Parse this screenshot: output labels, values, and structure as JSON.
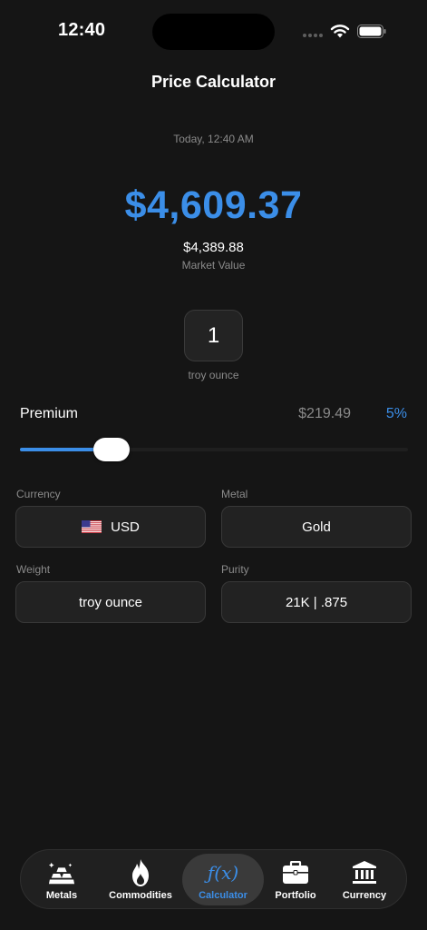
{
  "status": {
    "time": "12:40"
  },
  "header": {
    "title": "Price Calculator"
  },
  "summary": {
    "timestamp": "Today, 12:40 AM",
    "price": "$4,609.37",
    "market_value": "$4,389.88",
    "market_value_label": "Market Value"
  },
  "quantity": {
    "value": "1",
    "unit": "troy ounce"
  },
  "premium": {
    "label": "Premium",
    "amount": "$219.49",
    "percent": "5%",
    "slider_level": 0.19
  },
  "fields": {
    "currency": {
      "label": "Currency",
      "value": "USD",
      "flag": "us-flag-icon"
    },
    "metal": {
      "label": "Metal",
      "value": "Gold"
    },
    "weight": {
      "label": "Weight",
      "value": "troy ounce"
    },
    "purity": {
      "label": "Purity",
      "value": "21K | .875"
    }
  },
  "tabs": [
    {
      "label": "Metals",
      "icon": "gold-bars-icon",
      "active": false
    },
    {
      "label": "Commodities",
      "icon": "flame-icon",
      "active": false
    },
    {
      "label": "Calculator",
      "icon": "function-icon",
      "active": true
    },
    {
      "label": "Portfolio",
      "icon": "briefcase-icon",
      "active": false
    },
    {
      "label": "Currency",
      "icon": "bank-icon",
      "active": false
    }
  ],
  "colors": {
    "accent": "#3b8ee8",
    "background": "#151515",
    "field": "#222222"
  }
}
